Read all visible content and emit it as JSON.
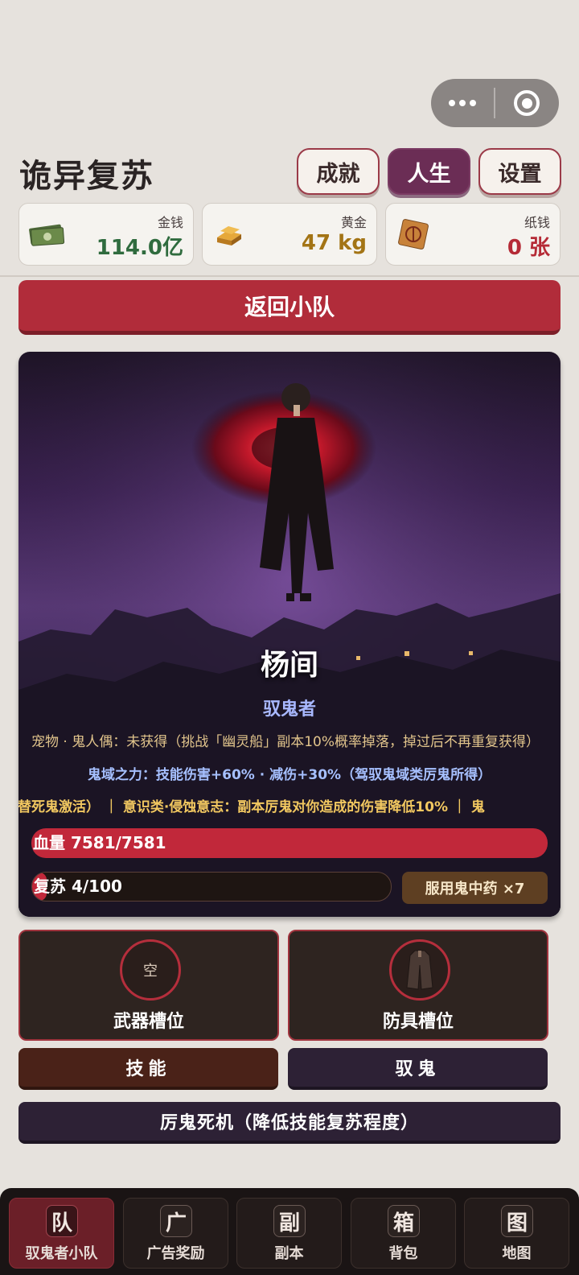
{
  "header": {
    "title": "诡异复苏",
    "buttons": [
      {
        "label": "成就",
        "active": false
      },
      {
        "label": "人生",
        "active": true
      },
      {
        "label": "设置",
        "active": false
      }
    ]
  },
  "resources": [
    {
      "label": "金钱",
      "value": "114.0亿",
      "icon": "cash-icon",
      "color": "#2f6b3e"
    },
    {
      "label": "黄金",
      "value": "47 kg",
      "icon": "gold-bar-icon",
      "color": "#a37415"
    },
    {
      "label": "纸钱",
      "value": "0 张",
      "icon": "paper-money-icon",
      "color": "#b52a36"
    }
  ],
  "back_button": "返回小队",
  "hero": {
    "name": "杨间",
    "class": "驭鬼者",
    "pet_line": "宠物 · 鬼人偶：未获得（挑战「幽灵船」副本10%概率掉落，掉过后不再重复获得）",
    "domain_line": "鬼域之力：技能伤害+60% · 减伤+30%（驾驭鬼域类厉鬼所得）",
    "trait_line": "（替死鬼激活） ｜ 意识类·侵蚀意志：副本厉鬼对你造成的伤害降低10% ｜ 鬼",
    "hp_text": "血量 7581/7581",
    "hp": {
      "current": 7581,
      "max": 7581
    },
    "revive_text": "复苏 4/100",
    "revive": {
      "current": 4,
      "max": 100
    },
    "potion_button": "服用鬼中药 ×7"
  },
  "slots": [
    {
      "label": "武器槽位",
      "content": "空",
      "icon": "empty-slot"
    },
    {
      "label": "防具槽位",
      "content": "",
      "icon": "coat-armor-icon"
    }
  ],
  "actions": {
    "skill": "技能",
    "ghost": "驭鬼",
    "deathtrap": "厉鬼死机（降低技能复苏程度）"
  },
  "tabs": [
    {
      "glyph": "队",
      "label": "驭鬼者小队",
      "active": true
    },
    {
      "glyph": "广",
      "label": "广告奖励",
      "active": false
    },
    {
      "glyph": "副",
      "label": "副本",
      "active": false
    },
    {
      "glyph": "箱",
      "label": "背包",
      "active": false
    },
    {
      "glyph": "图",
      "label": "地图",
      "active": false
    }
  ],
  "colors": {
    "accent_red": "#b12c3a",
    "active_tab": "#6b1f28",
    "life_button": "#6b2d55"
  }
}
